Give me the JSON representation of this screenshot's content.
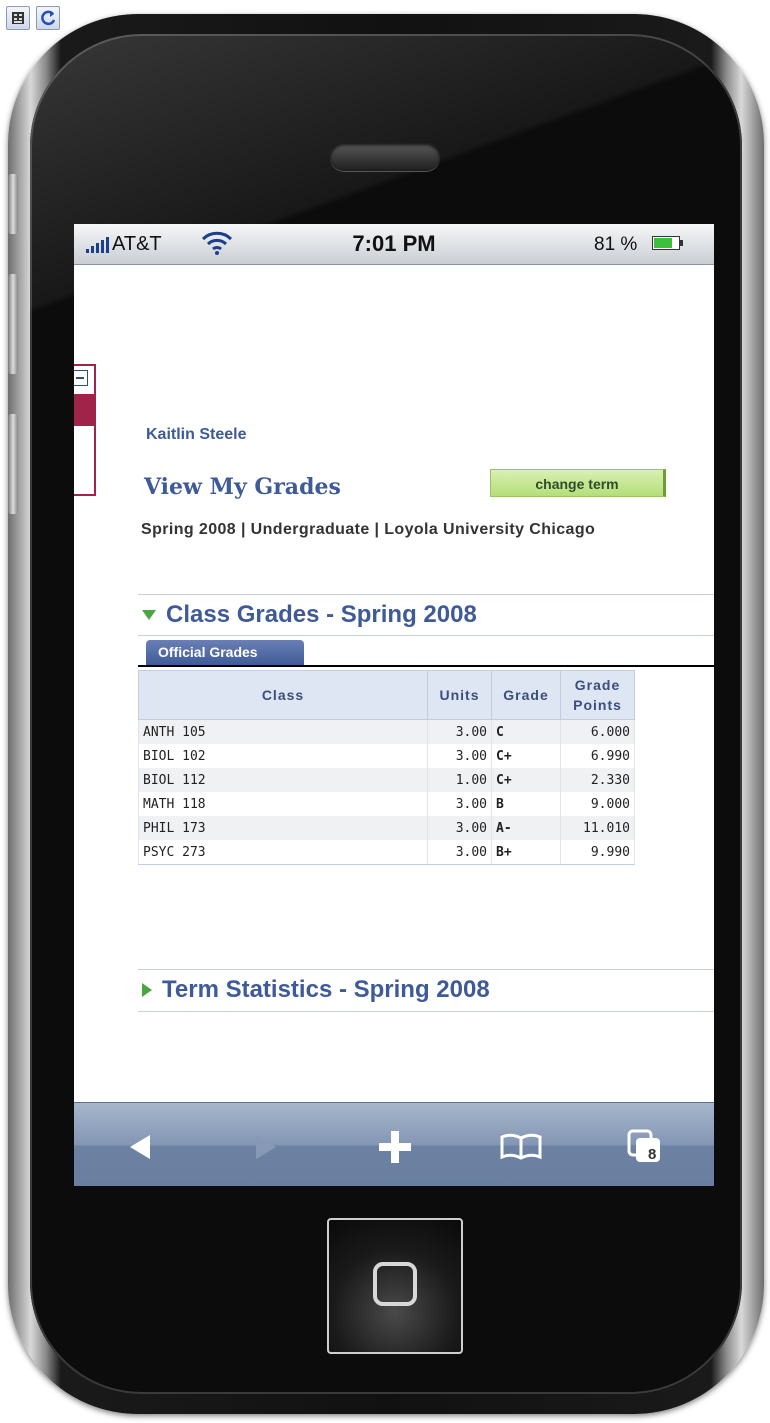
{
  "statusbar": {
    "carrier": "AT&T",
    "time": "7:01 PM",
    "battery": "81 %",
    "battery_level": 0.81
  },
  "page": {
    "user_name": "Kaitlin Steele",
    "title": "View My Grades",
    "change_term_label": "change term",
    "term_info": "Spring 2008 | Undergraduate | Loyola University Chicago"
  },
  "class_grades": {
    "heading": "Class Grades - Spring 2008",
    "tab_label": "Official Grades",
    "columns": {
      "class": "Class",
      "units": "Units",
      "grade": "Grade",
      "grade_points": "Grade Points"
    },
    "rows": [
      {
        "class": "ANTH 105",
        "units": "3.00",
        "grade": "C",
        "points": "6.000"
      },
      {
        "class": "BIOL 102",
        "units": "3.00",
        "grade": "C+",
        "points": "6.990"
      },
      {
        "class": "BIOL 112",
        "units": "1.00",
        "grade": "C+",
        "points": "2.330"
      },
      {
        "class": "MATH 118",
        "units": "3.00",
        "grade": "B",
        "points": "9.000"
      },
      {
        "class": "PHIL 173",
        "units": "3.00",
        "grade": "A-",
        "points": "11.010"
      },
      {
        "class": "PSYC 273",
        "units": "3.00",
        "grade": "B+",
        "points": "9.990"
      }
    ]
  },
  "term_statistics": {
    "heading": "Term Statistics - Spring 2008"
  },
  "toolbar": {
    "tabs_count": "8",
    "icons": [
      "back-arrow-icon",
      "forward-arrow-icon",
      "plus-icon",
      "bookmarks-icon",
      "tabs-icon"
    ]
  },
  "colors": {
    "accent": "#3e5a98",
    "button_green": "#b4de79",
    "expander_green": "#4ca543",
    "side_widget": "#a0244a"
  }
}
